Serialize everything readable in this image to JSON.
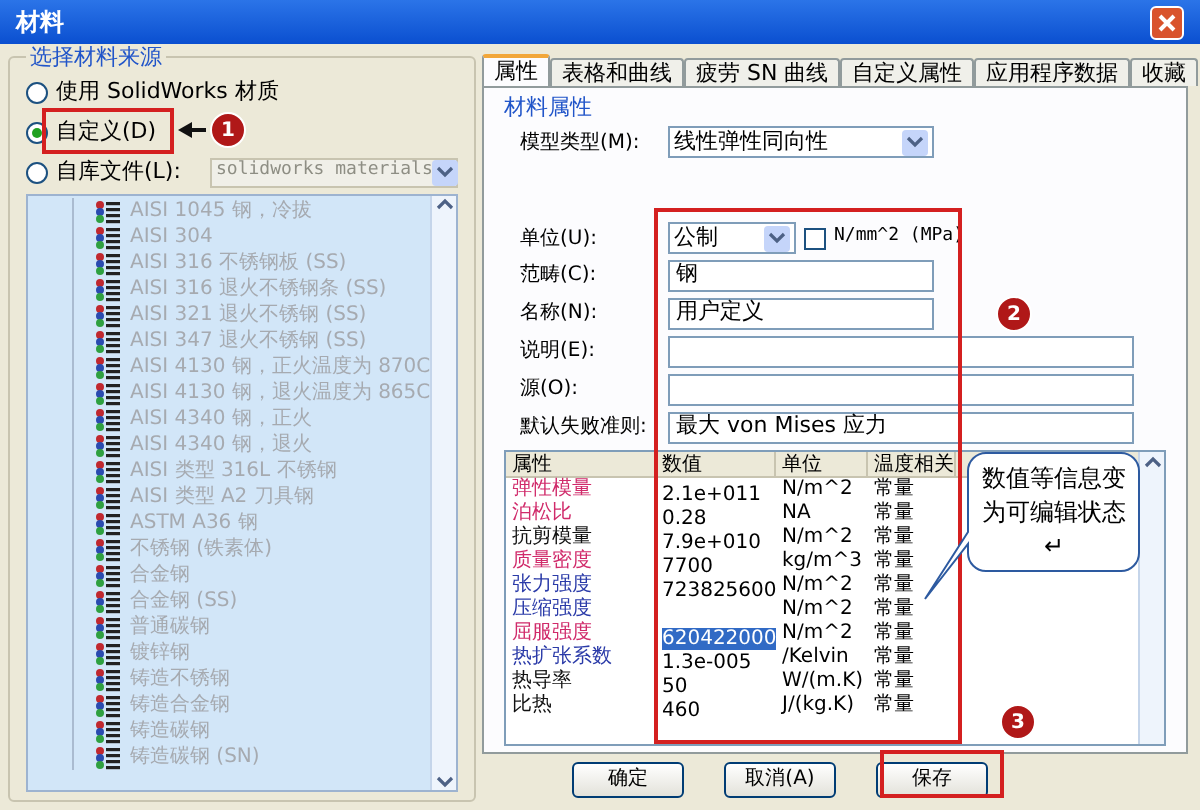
{
  "window": {
    "title": "材料"
  },
  "source": {
    "title": "选择材料来源",
    "options": [
      {
        "label": "使用 SolidWorks 材质",
        "selected": false
      },
      {
        "label": "自定义(D)",
        "selected": true
      },
      {
        "label": "自库文件(L):",
        "selected": false
      }
    ],
    "library": {
      "value": "solidworks materials",
      "disabled": true
    },
    "list_disabled": true,
    "materials": [
      "AISI 1045 钢，冷拔",
      "AISI 304",
      "AISI 316 不锈钢板 (SS)",
      "AISI 316 退火不锈钢条 (SS)",
      "AISI 321 退火不锈钢 (SS)",
      "AISI 347 退火不锈钢 (SS)",
      "AISI 4130 钢，正火温度为 870C",
      "AISI 4130 钢，退火温度为 865C",
      "AISI 4340 钢，正火",
      "AISI 4340 钢，退火",
      "AISI 类型 316L 不锈钢",
      "AISI 类型 A2 刀具钢",
      "ASTM A36 钢",
      "不锈钢 (铁素体)",
      "合金钢",
      "合金钢 (SS)",
      "普通碳钢",
      "镀锌钢",
      "铸造不锈钢",
      "铸造合金钢",
      "铸造碳钢",
      "铸造碳钢 (SN)"
    ]
  },
  "tabs": [
    {
      "label": "属性",
      "selected": true
    },
    {
      "label": "表格和曲线",
      "selected": false
    },
    {
      "label": "疲劳 SN 曲线",
      "selected": false
    },
    {
      "label": "自定义属性",
      "selected": false
    },
    {
      "label": "应用程序数据",
      "selected": false
    },
    {
      "label": "收藏",
      "selected": false
    }
  ],
  "properties": {
    "section": "材料属性",
    "model_type": {
      "label": "模型类型(M):",
      "value": "线性弹性同向性"
    },
    "units": {
      "label": "单位(U):",
      "value": "公制",
      "checkbox": {
        "label": "N/mm^2 (MPa)",
        "checked": false
      }
    },
    "fields": [
      {
        "label": "范畴(C):",
        "value": "钢"
      },
      {
        "label": "名称(N):",
        "value": "用户定义"
      },
      {
        "label": "说明(E):"
      },
      {
        "label": "源(O):"
      }
    ],
    "criterion": {
      "label": "默认失败准则:",
      "value": "最大 von Mises 应力"
    }
  },
  "table": {
    "columns": [
      "属性",
      "数值",
      "单位",
      "温度相关"
    ],
    "rows": [
      {
        "name": "弹性模量",
        "color": "#d02a6a",
        "value": "2.1e+011",
        "unit": "N/m^2",
        "temp": "常量",
        "selected": false
      },
      {
        "name": "泊松比",
        "color": "#d02a6a",
        "value": "0.28",
        "unit": "NA",
        "temp": "常量",
        "selected": false
      },
      {
        "name": "抗剪模量",
        "color": "#111111",
        "value": "7.9e+010",
        "unit": "N/m^2",
        "temp": "常量",
        "selected": false
      },
      {
        "name": "质量密度",
        "color": "#d02a6a",
        "value": "7700",
        "unit": "kg/m^3",
        "temp": "常量",
        "selected": false
      },
      {
        "name": "张力强度",
        "color": "#2a3aa8",
        "value": "723825600",
        "unit": "N/m^2",
        "temp": "常量",
        "selected": false
      },
      {
        "name": "压缩强度",
        "color": "#2a3aa8",
        "unit": "N/m^2",
        "temp": "常量",
        "selected": false
      },
      {
        "name": "屈服强度",
        "color": "#d02a6a",
        "value": "620422000",
        "unit": "N/m^2",
        "temp": "常量",
        "selected": true
      },
      {
        "name": "热扩张系数",
        "color": "#2a3aa8",
        "value": "1.3e-005",
        "unit": "/Kelvin",
        "temp": "常量",
        "selected": false
      },
      {
        "name": "热导率",
        "color": "#111111",
        "value": "50",
        "unit": "W/(m.K)",
        "temp": "常量",
        "selected": false
      },
      {
        "name": "比热",
        "color": "#111111",
        "value": "460",
        "unit": "J/(kg.K)",
        "temp": "常量",
        "selected": false
      }
    ]
  },
  "buttons": [
    "确定",
    "取消(A)",
    "保存"
  ],
  "annotations": {
    "markers": [
      "1",
      "2",
      "3"
    ],
    "callout": "数值等信息变为可编辑状态↵"
  }
}
